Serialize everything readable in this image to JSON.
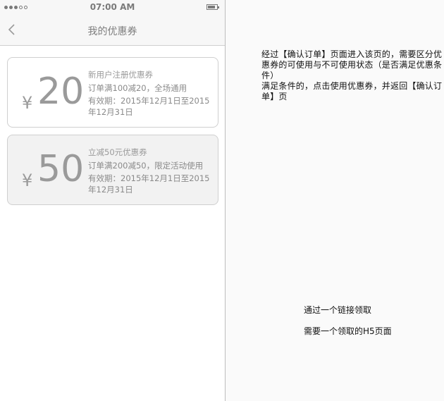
{
  "status_bar": {
    "time": "07:00 AM",
    "signal": "●●●○○"
  },
  "nav": {
    "title": "我的优惠券",
    "back_icon": "chevron-left-icon"
  },
  "coupons": [
    {
      "currency": "¥",
      "amount": "20",
      "name": "新用户注册优惠券",
      "rule": "订单满100减20，全场通用",
      "validity": "有效期：2015年12月1日至2015年12月31日"
    },
    {
      "currency": "¥",
      "amount": "50",
      "name": "立减50元优惠券",
      "rule": "订单满200减50，限定活动使用",
      "validity": "有效期：2015年12月1日至2015年12月31日"
    }
  ],
  "annotations": {
    "note1_line1": "经过【确认订单】页面进入该页的，需要区分优惠券的可使用与不可使用状态（是否满足优惠条件）",
    "note1_line2": "满足条件的，点击使用优惠券，并返回【确认订单】页",
    "note2": "通过一个链接领取",
    "note3": "需要一个领取的H5页面"
  },
  "colors": {
    "card_available_bg": "#ffffff",
    "card_unavailable_bg": "#f2f2f2",
    "text_gray": "#9a9a9a"
  }
}
